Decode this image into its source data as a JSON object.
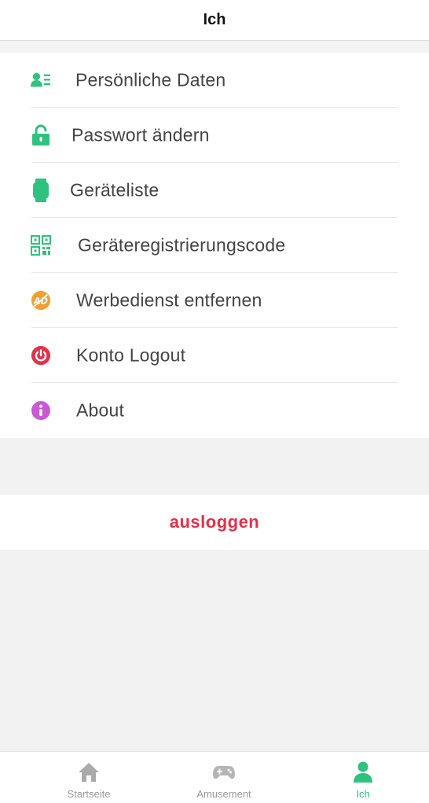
{
  "header": {
    "title": "Ich"
  },
  "menu": {
    "items": [
      {
        "label": "Persönliche Daten",
        "icon": "contact-card-icon",
        "color": "#2ec27e"
      },
      {
        "label": "Passwort ändern",
        "icon": "lock-icon",
        "color": "#2ec27e"
      },
      {
        "label": "Geräteliste",
        "icon": "watch-icon",
        "color": "#2ec27e"
      },
      {
        "label": "Geräteregistrierungscode",
        "icon": "qr-code-icon",
        "color": "#2ec27e"
      },
      {
        "label": "Werbedienst entfernen",
        "icon": "no-ads-icon",
        "color": "#f0a030"
      },
      {
        "label": "Konto Logout",
        "icon": "power-icon",
        "color": "#e5304a"
      },
      {
        "label": "About",
        "icon": "info-icon",
        "color": "#c85ad6"
      }
    ]
  },
  "logout": {
    "label": "ausloggen",
    "color": "#e5304a"
  },
  "tabbar": {
    "tabs": [
      {
        "label": "Startseite",
        "icon": "home-icon"
      },
      {
        "label": "Amusement",
        "icon": "gamepad-icon"
      },
      {
        "label": "Ich",
        "icon": "person-icon",
        "active": true,
        "color": "#2ec27e"
      }
    ]
  }
}
